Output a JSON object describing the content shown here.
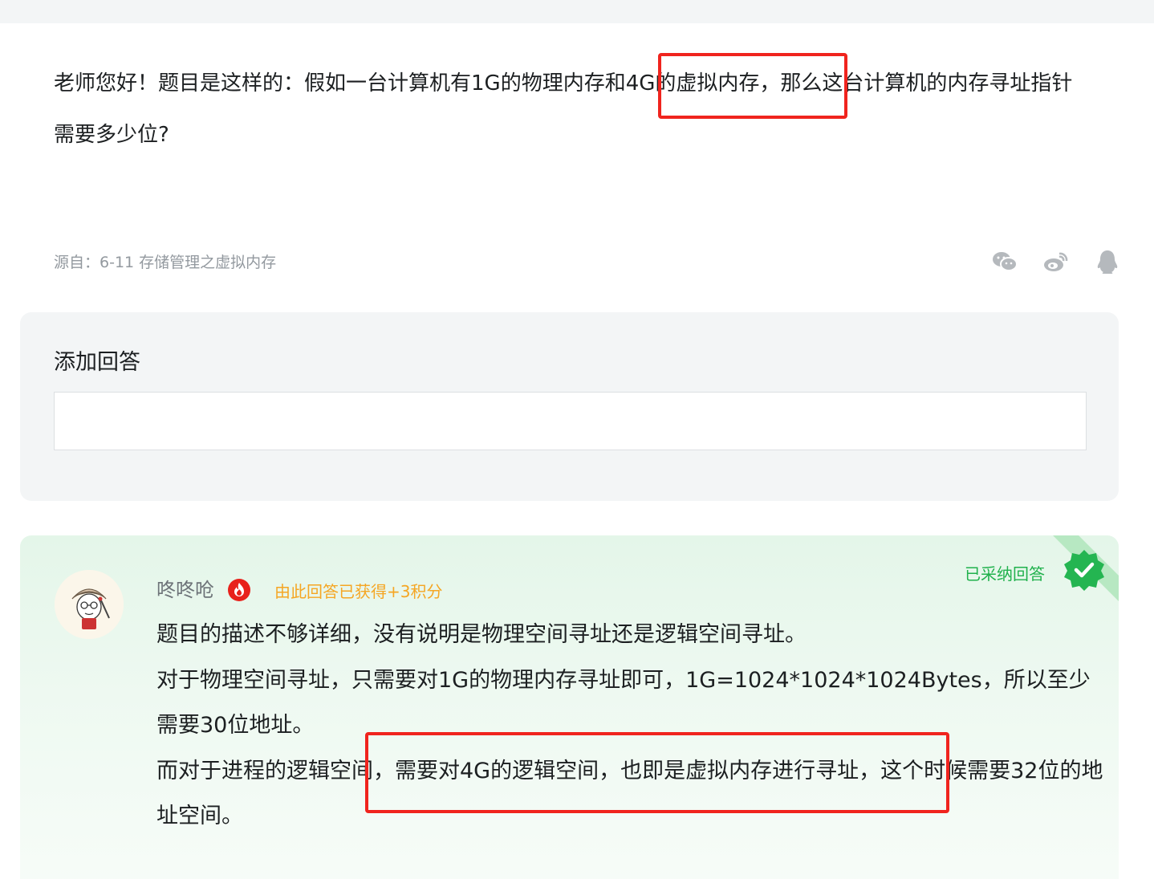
{
  "question": {
    "text": "老师您好！题目是这样的：假如一台计算机有1G的物理内存和4G的虚拟内存，那么这台计算机的内存寻址指针需要多少位?"
  },
  "source": {
    "text": "源自：6-11 存储管理之虚拟内存"
  },
  "share": {
    "icons": [
      "wechat-icon",
      "weibo-icon",
      "qq-icon"
    ]
  },
  "add_answer": {
    "title": "添加回答",
    "placeholder": ""
  },
  "accepted_answer": {
    "username": "咚咚呛",
    "points_text": "由此回答已获得+3积分",
    "accepted_label": "已采纳回答",
    "paragraphs": [
      "题目的描述不够详细，没有说明是物理空间寻址还是逻辑空间寻址。",
      "对于物理空间寻址，只需要对1G的物理内存寻址即可，1G=1024*1024*1024Bytes，所以至少需要30位地址。",
      "而对于进程的逻辑空间，需要对4G的逻辑空间，也即是虚拟内存进行寻址，这个时候需要32位的地址空间。"
    ]
  },
  "colors": {
    "accent_green": "#20b14c",
    "points_orange": "#f5a623",
    "highlight_red": "#f0241e",
    "muted_text": "#93999f"
  }
}
